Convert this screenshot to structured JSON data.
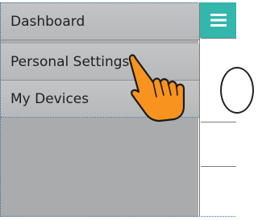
{
  "menu": {
    "items": [
      {
        "label": "Dashboard"
      },
      {
        "label": "Personal Settings"
      },
      {
        "label": "My Devices"
      }
    ]
  },
  "header": {
    "menu_icon": "hamburger-icon",
    "accent_color": "#33b6ab"
  },
  "overlay": {
    "pointer_icon": "tap-hand-icon",
    "pointer_color": "#f7931e"
  }
}
